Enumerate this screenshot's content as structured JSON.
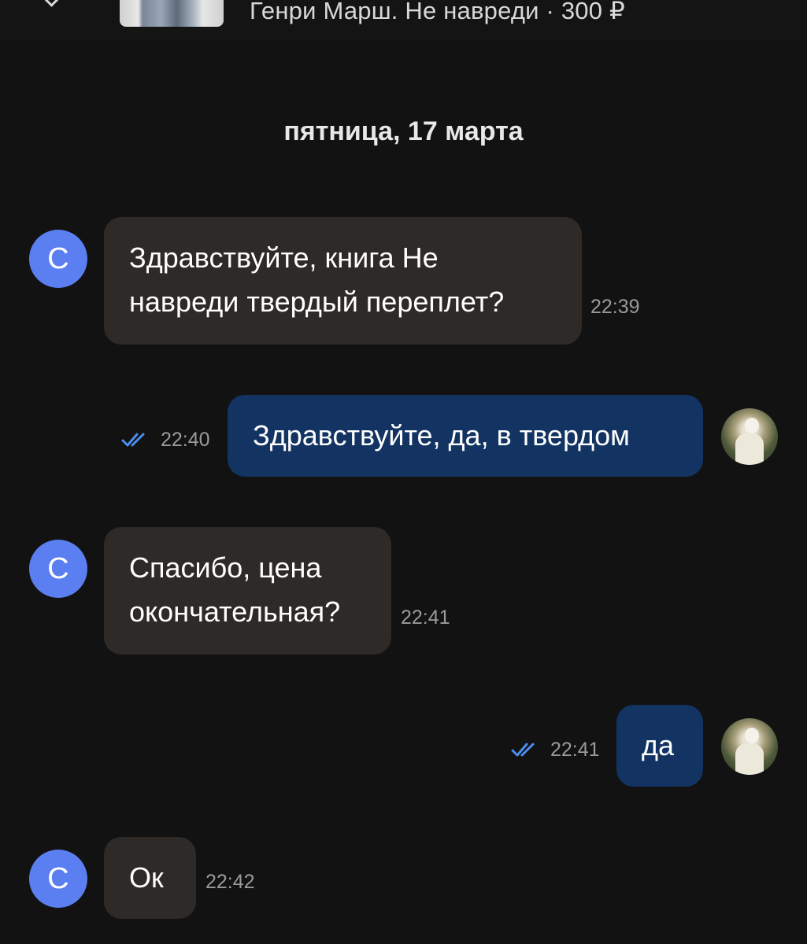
{
  "header": {
    "product_title": "Генри Марш. Не навреди · 300 ₽"
  },
  "date_separator": "пятница, 17 марта",
  "messages": [
    {
      "side": "in",
      "avatar": "С",
      "lines": [
        "Здравствуйте, книга Не",
        "навреди твердый переплет?"
      ],
      "time": "22:39"
    },
    {
      "side": "out",
      "lines": [
        "Здравствуйте, да, в твердом"
      ],
      "time": "22:40",
      "status": "read"
    },
    {
      "side": "in",
      "avatar": "С",
      "lines": [
        "Спасибо, цена",
        "окончательная?"
      ],
      "time": "22:41"
    },
    {
      "side": "out",
      "lines": [
        "да"
      ],
      "time": "22:41",
      "status": "read"
    },
    {
      "side": "in",
      "avatar": "С",
      "lines": [
        "Ок"
      ],
      "time": "22:42"
    }
  ],
  "colors": {
    "background": "#121212",
    "incoming_bubble": "#2d2a27",
    "outgoing_bubble": "#133462",
    "avatar": "#5b7ff0",
    "read_ticks": "#4b8ef0",
    "time_text": "#9a9a9a"
  }
}
